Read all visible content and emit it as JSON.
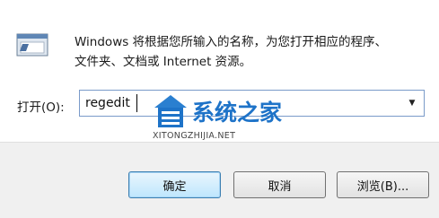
{
  "dialog": {
    "description_line1": "Windows 将根据您所输入的名称，为您打开相应的程序、",
    "description_line2": "文件夹、文档或 Internet 资源。",
    "icon": "run-program-icon"
  },
  "open": {
    "label": "打开(O):",
    "value": "regedit"
  },
  "watermark": {
    "title": "系统之家",
    "url": "XITONGZHIJIA.NET"
  },
  "buttons": {
    "ok": "确定",
    "cancel": "取消",
    "browse": "浏览(B)..."
  },
  "colors": {
    "accent": "#3c7fb1",
    "watermark_blue": "#1e73c8"
  }
}
